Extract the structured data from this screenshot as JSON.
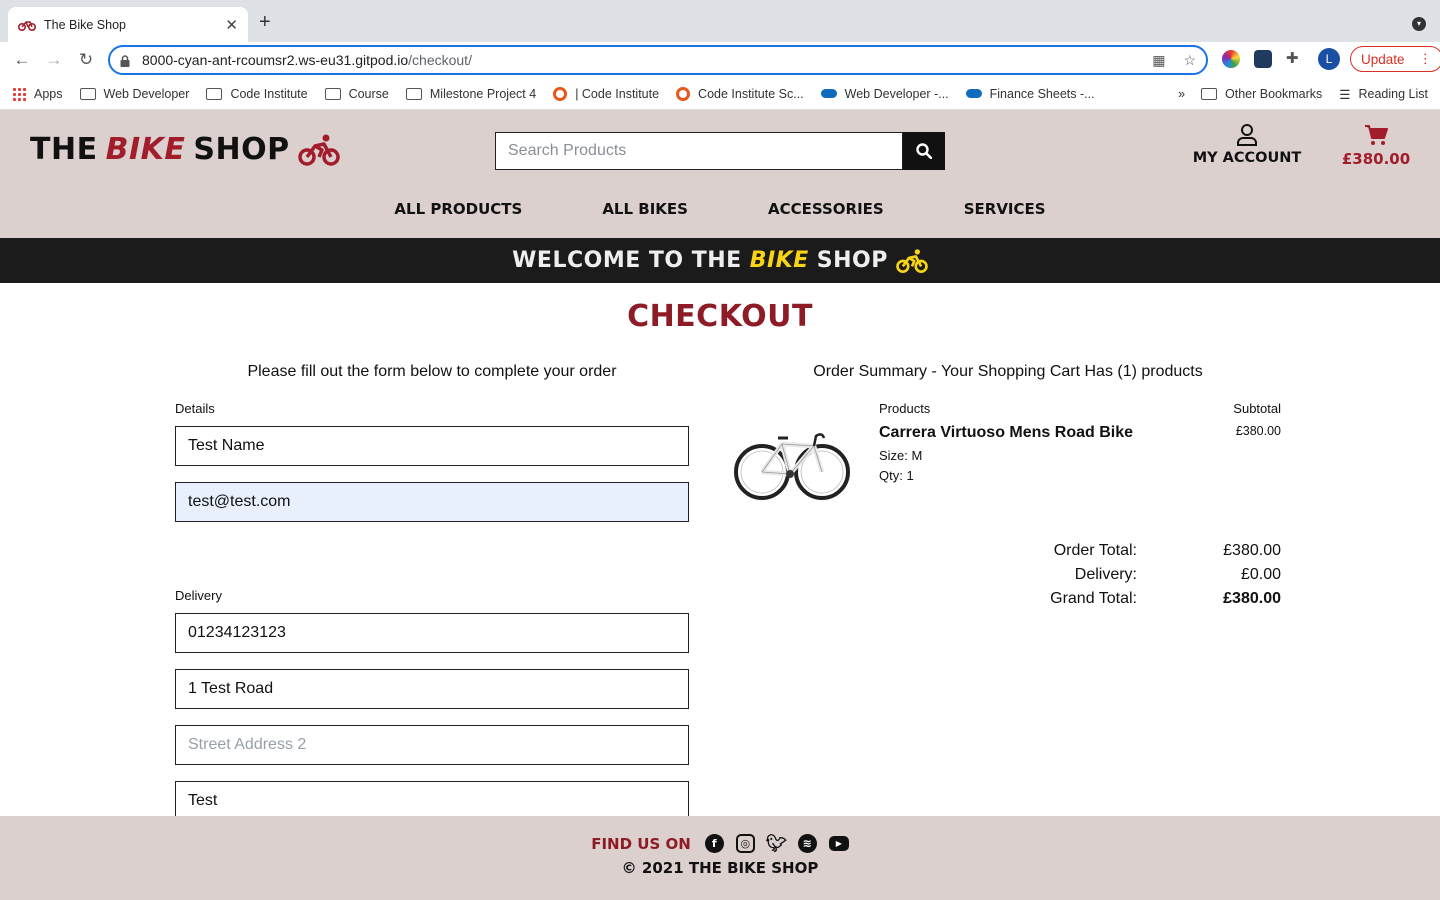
{
  "browser": {
    "tab_title": "The Bike Shop",
    "url_host": "8000-cyan-ant-rcoumsr2.ws-eu31.gitpod.io",
    "url_path": "/checkout/",
    "profile_initial": "L",
    "update_label": "Update",
    "bookmarks": [
      {
        "label": "Apps",
        "icon": "apps-grid-icon"
      },
      {
        "label": "Web Developer",
        "icon": "folder-icon"
      },
      {
        "label": "Code Institute",
        "icon": "folder-icon"
      },
      {
        "label": "Course",
        "icon": "folder-icon"
      },
      {
        "label": "Milestone Project 4",
        "icon": "folder-icon"
      },
      {
        "label": "| Code Institute",
        "icon": "code-institute-icon"
      },
      {
        "label": "Code Institute Sc...",
        "icon": "code-institute-icon"
      },
      {
        "label": "Web Developer -...",
        "icon": "onedrive-icon"
      },
      {
        "label": "Finance Sheets -...",
        "icon": "onedrive-icon"
      }
    ],
    "bookmarks_overflow": "»",
    "other_bookmarks": "Other Bookmarks",
    "reading_list": "Reading List"
  },
  "header": {
    "logo_the": "THE",
    "logo_bike": "BIKE",
    "logo_shop": "SHOP",
    "search_placeholder": "Search Products",
    "account_label": "MY ACCOUNT",
    "bag_total": "£380.00",
    "nav": [
      "ALL PRODUCTS",
      "ALL BIKES",
      "ACCESSORIES",
      "SERVICES"
    ],
    "brand_color": "#a11d2b"
  },
  "banner": {
    "pre": "WELCOME TO THE",
    "bike": "BIKE",
    "post": "SHOP",
    "accent_color": "#f7d416"
  },
  "checkout": {
    "title": "CHECKOUT",
    "form_intro": "Please fill out the form below to complete your order",
    "details_label": "Details",
    "full_name": "Test Name",
    "email": "test@test.com",
    "delivery_label": "Delivery",
    "phone": "01234123123",
    "street1": "1 Test Road",
    "street2_placeholder": "Street Address 2",
    "town": "Test"
  },
  "summary": {
    "intro": "Order Summary - Your Shopping Cart Has (1) products",
    "col_products": "Products",
    "col_subtotal": "Subtotal",
    "items": [
      {
        "name": "Carrera Virtuoso Mens Road Bike",
        "size": "Size: M",
        "qty": "Qty: 1",
        "subtotal": "£380.00"
      }
    ],
    "order_total_label": "Order Total:",
    "order_total": "£380.00",
    "delivery_label": "Delivery:",
    "delivery": "£0.00",
    "grand_total_label": "Grand Total:",
    "grand_total": "£380.00"
  },
  "footer": {
    "find_us": "FIND US ON",
    "social": [
      "facebook-icon",
      "instagram-icon",
      "twitter-icon",
      "spotify-icon",
      "youtube-icon"
    ],
    "copyright": "© 2021 THE BIKE SHOP"
  }
}
